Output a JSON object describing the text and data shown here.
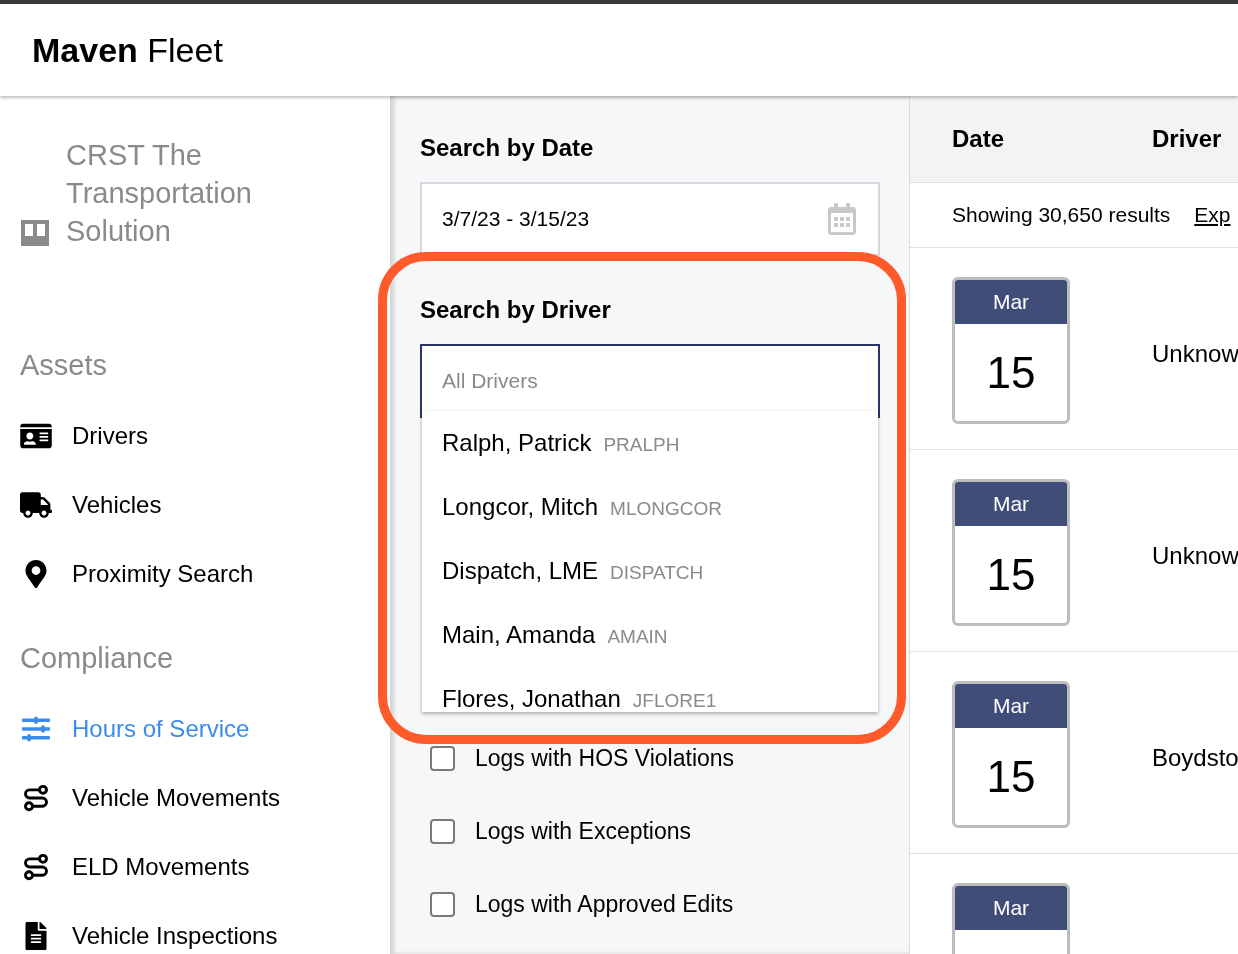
{
  "app": {
    "title": "**Maven** Fleet"
  },
  "sidebar": {
    "company": "CRST The Transportation Solution",
    "sections": [
      {
        "title": "Assets",
        "items": [
          {
            "label": "Drivers",
            "kind": "id-card",
            "selected": false
          },
          {
            "label": "Vehicles",
            "kind": "truck",
            "selected": false
          },
          {
            "label": "Proximity Search",
            "kind": "pin",
            "selected": false
          }
        ]
      },
      {
        "title": "Compliance",
        "items": [
          {
            "label": "Hours of Service",
            "kind": "sliders",
            "selected": true
          },
          {
            "label": "Vehicle Movements",
            "kind": "route",
            "selected": false
          },
          {
            "label": "ELD Movements",
            "kind": "route",
            "selected": false
          },
          {
            "label": "Vehicle Inspections",
            "kind": "document",
            "selected": false
          }
        ]
      }
    ]
  },
  "filters": {
    "search_by_date": {
      "label": "Search by Date",
      "value": "3/7/23 - 3/15/23"
    },
    "search_by_driver": {
      "label": "Search by Driver",
      "placeholder": "All Drivers",
      "options": [
        {
          "name": "Ralph, Patrick",
          "code": "PRALPH"
        },
        {
          "name": "Longcor, Mitch",
          "code": "MLONGCOR"
        },
        {
          "name": "Dispatch, LME",
          "code": "DISPATCH"
        },
        {
          "name": "Main, Amanda",
          "code": "AMAIN"
        },
        {
          "name": "Flores, Jonathan",
          "code": "JFLORE1"
        }
      ]
    },
    "checkboxes": [
      {
        "label": "Logs with HOS Violations",
        "checked": false
      },
      {
        "label": "Logs with Exceptions",
        "checked": false
      },
      {
        "label": "Logs with Approved Edits",
        "checked": false
      }
    ]
  },
  "results": {
    "columns": [
      "Date",
      "Driver"
    ],
    "summary": "Showing 30,650 results",
    "link": "Exp",
    "rows": [
      {
        "month": "Mar",
        "day": "15",
        "driver": "Unknow"
      },
      {
        "month": "Mar",
        "day": "15",
        "driver": "Unknow"
      },
      {
        "month": "Mar",
        "day": "15",
        "driver": "Boydsto"
      },
      {
        "month": "Mar"
      }
    ]
  }
}
